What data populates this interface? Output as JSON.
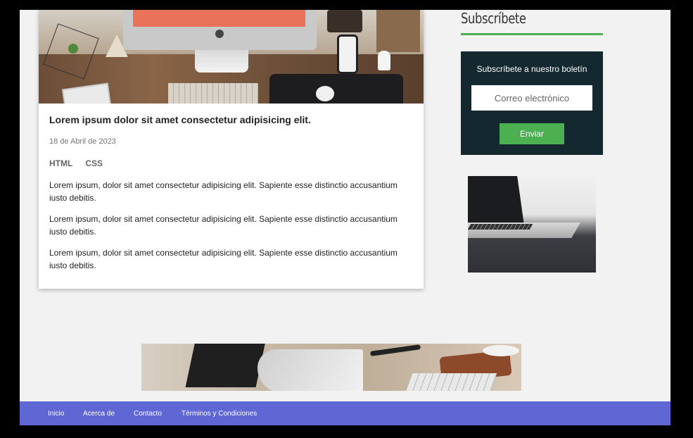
{
  "article": {
    "title": "Lorem ipsum dolor sit amet consectetur adipisicing elit.",
    "date": "18 de Abril de 2023",
    "tags": [
      "HTML",
      "CSS"
    ],
    "paragraphs": [
      "Lorem ipsum, dolor sit amet consectetur adipisicing elit. Sapiente esse distinctio accusantium iusto debitis.",
      "Lorem ipsum, dolor sit amet consectetur adipisicing elit. Sapiente esse distinctio accusantium iusto debitis.",
      "Lorem ipsum, dolor sit amet consectetur adipisicing elit. Sapiente esse distinctio accusantium iusto debitis."
    ]
  },
  "sidebar": {
    "heading": "Subscríbete",
    "newsletter": {
      "heading": "Subscríbete a nuestro boletín",
      "email_placeholder": "Correo electrónico",
      "submit_label": "Enviar"
    }
  },
  "footer": {
    "links": [
      "Inicio",
      "Acerca de",
      "Contacto",
      "Términos y Condiciones"
    ]
  },
  "colors": {
    "accent_green": "#4caf50",
    "newsletter_bg": "#13282f",
    "footer_bg": "#5f67d4",
    "page_bg": "#f2f2f2"
  }
}
